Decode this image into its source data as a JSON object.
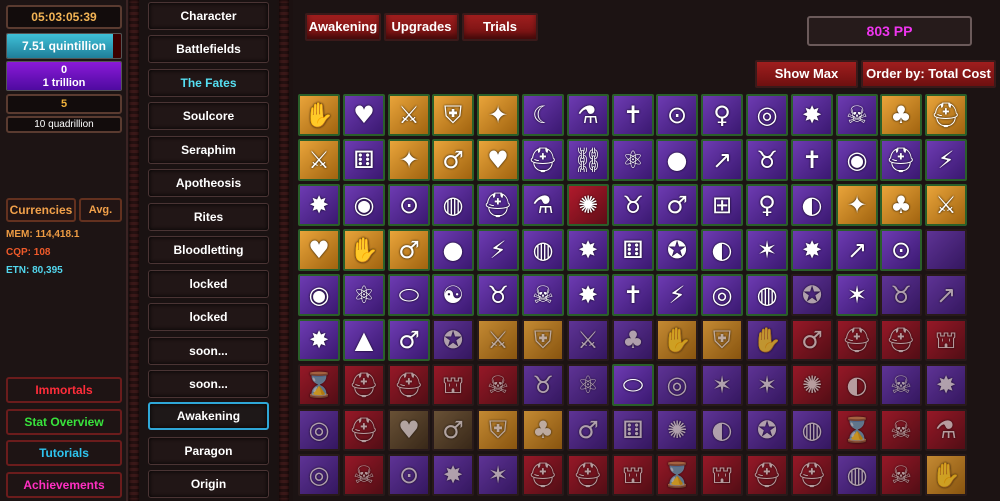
{
  "left": {
    "timer": "05:03:05:39",
    "bar1": {
      "label": "7.51 quintillion",
      "progress": 0.93
    },
    "bar2": {
      "line1": "0",
      "line2": "1 trillion",
      "progress": 1.0
    },
    "gold": "5",
    "quad": "10 quadrillion",
    "currencies": "Currencies",
    "avg": "Avg.",
    "mem": "MEM: 114,418.1",
    "cqp": "CQP: 108",
    "etn": "ETN: 80,395",
    "immortals": "Immortals",
    "stat_overview": "Stat Overview",
    "tutorials": "Tutorials",
    "achievements": "Achievements"
  },
  "nav": {
    "items": [
      {
        "label": "Character"
      },
      {
        "label": "Battlefields"
      },
      {
        "label": "The Fates"
      },
      {
        "label": "Soulcore"
      },
      {
        "label": "Seraphim"
      },
      {
        "label": "Apotheosis"
      },
      {
        "label": "Rites"
      },
      {
        "label": "Bloodletting"
      },
      {
        "label": "locked"
      },
      {
        "label": "locked"
      },
      {
        "label": "soon..."
      },
      {
        "label": "soon..."
      },
      {
        "label": "Awakening"
      },
      {
        "label": "Paragon"
      },
      {
        "label": "Origin"
      }
    ],
    "active": "Awakening"
  },
  "main": {
    "tabs": [
      {
        "label": "Awakening"
      },
      {
        "label": "Upgrades"
      },
      {
        "label": "Trials"
      }
    ],
    "pp": "803 PP",
    "show_max": "Show Max",
    "order_by": "Order by: Total Cost"
  },
  "grid": {
    "tiles": [
      {
        "c": "orange",
        "i": "claw-icon",
        "g": "✋",
        "l": false
      },
      {
        "c": "purple",
        "i": "heart-plus-icon",
        "g": "♥",
        "l": false
      },
      {
        "c": "orange",
        "i": "crossed-swords-icon",
        "g": "⚔",
        "l": false
      },
      {
        "c": "orange",
        "i": "shield-icon",
        "g": "⛨",
        "l": false
      },
      {
        "c": "orange",
        "i": "star-badge-icon",
        "g": "✦",
        "l": false
      },
      {
        "c": "purple",
        "i": "moon-face-icon",
        "g": "☾",
        "l": false
      },
      {
        "c": "purple",
        "i": "flask-icon",
        "g": "⚗",
        "l": false
      },
      {
        "c": "purple",
        "i": "angel-icon",
        "g": "✝",
        "l": false
      },
      {
        "c": "purple",
        "i": "keyhole-icon",
        "g": "⊙",
        "l": false
      },
      {
        "c": "purple",
        "i": "figure-icon",
        "g": "♀",
        "l": false
      },
      {
        "c": "purple",
        "i": "spiral-icon",
        "g": "◎",
        "l": false
      },
      {
        "c": "purple",
        "i": "explosion-icon",
        "g": "✸",
        "l": false
      },
      {
        "c": "purple",
        "i": "skull-icon",
        "g": "☠",
        "l": false
      },
      {
        "c": "orange",
        "i": "clover-icon",
        "g": "♣",
        "l": false
      },
      {
        "c": "orange",
        "i": "helmet-icon",
        "g": "⛑",
        "l": false
      },
      {
        "c": "orange",
        "i": "crossed-swords-icon",
        "g": "⚔",
        "l": false
      },
      {
        "c": "purple",
        "i": "dice-icon",
        "g": "⚅",
        "l": false
      },
      {
        "c": "orange",
        "i": "star-badge-icon",
        "g": "✦",
        "l": false
      },
      {
        "c": "orange",
        "i": "figure-icon",
        "g": "♂",
        "l": false
      },
      {
        "c": "orange",
        "i": "heart-plus-icon",
        "g": "♥",
        "l": false
      },
      {
        "c": "purple",
        "i": "helmet-icon",
        "g": "⛑",
        "l": false
      },
      {
        "c": "purple",
        "i": "chain-icon",
        "g": "⛓",
        "l": false
      },
      {
        "c": "purple",
        "i": "triskele-icon",
        "g": "⚛",
        "l": false
      },
      {
        "c": "purple",
        "i": "orb-icon",
        "g": "●",
        "l": false
      },
      {
        "c": "purple",
        "i": "growth-chart-icon",
        "g": "↗",
        "l": false
      },
      {
        "c": "purple",
        "i": "demon-icon",
        "g": "♉",
        "l": false
      },
      {
        "c": "purple",
        "i": "angel-icon",
        "g": "✝",
        "l": false
      },
      {
        "c": "purple",
        "i": "vortex-icon",
        "g": "◉",
        "l": false
      },
      {
        "c": "purple",
        "i": "helmet-icon",
        "g": "⛑",
        "l": false
      },
      {
        "c": "purple",
        "i": "lightning-icon",
        "g": "⚡",
        "l": false
      },
      {
        "c": "purple",
        "i": "explosion-icon",
        "g": "✸",
        "l": false
      },
      {
        "c": "purple",
        "i": "vortex-icon",
        "g": "◉",
        "l": false
      },
      {
        "c": "purple",
        "i": "keyhole-icon",
        "g": "⊙",
        "l": false
      },
      {
        "c": "purple",
        "i": "globe-icon",
        "g": "◍",
        "l": false
      },
      {
        "c": "purple",
        "i": "helmet-icon",
        "g": "⛑",
        "l": false
      },
      {
        "c": "purple",
        "i": "flask-icon",
        "g": "⚗",
        "l": false
      },
      {
        "c": "red",
        "i": "sunburst-icon",
        "g": "✺",
        "l": false
      },
      {
        "c": "purple",
        "i": "demon-face-icon",
        "g": "♉",
        "l": false
      },
      {
        "c": "purple",
        "i": "figure-icon",
        "g": "♂",
        "l": false
      },
      {
        "c": "purple",
        "i": "network-icon",
        "g": "⊞",
        "l": false
      },
      {
        "c": "purple",
        "i": "figure-icon",
        "g": "♀",
        "l": false
      },
      {
        "c": "purple",
        "i": "eye-icon",
        "g": "◐",
        "l": false
      },
      {
        "c": "orange",
        "i": "star-badge-icon",
        "g": "✦",
        "l": false
      },
      {
        "c": "orange",
        "i": "clover-icon",
        "g": "♣",
        "l": false
      },
      {
        "c": "orange",
        "i": "crossed-swords-icon",
        "g": "⚔",
        "l": false
      },
      {
        "c": "orange",
        "i": "heart-plus-icon",
        "g": "♥",
        "l": false
      },
      {
        "c": "orange",
        "i": "claw-icon",
        "g": "✋",
        "l": false
      },
      {
        "c": "orange",
        "i": "figure-icon",
        "g": "♂",
        "l": false
      },
      {
        "c": "purple",
        "i": "orb-icon",
        "g": "●",
        "l": false
      },
      {
        "c": "purple",
        "i": "lightning-icon",
        "g": "⚡",
        "l": false
      },
      {
        "c": "purple",
        "i": "globe-icon",
        "g": "◍",
        "l": false
      },
      {
        "c": "purple",
        "i": "explosion-icon",
        "g": "✸",
        "l": false
      },
      {
        "c": "purple",
        "i": "dice-icon",
        "g": "⚅",
        "l": false
      },
      {
        "c": "purple",
        "i": "thorn-ring-icon",
        "g": "✪",
        "l": false
      },
      {
        "c": "purple",
        "i": "eye-icon",
        "g": "◐",
        "l": false
      },
      {
        "c": "purple",
        "i": "heptagram-icon",
        "g": "✶",
        "l": false
      },
      {
        "c": "purple",
        "i": "explosion-icon",
        "g": "✸",
        "l": false
      },
      {
        "c": "purple",
        "i": "growth-chart-icon",
        "g": "↗",
        "l": false
      },
      {
        "c": "purple",
        "i": "keyhole-icon",
        "g": "⊙",
        "l": false
      },
      {
        "c": "purple",
        "i": "blank-icon",
        "g": "",
        "l": true
      },
      {
        "c": "purple",
        "i": "vortex-icon",
        "g": "◉",
        "l": false
      },
      {
        "c": "purple",
        "i": "triskele-icon",
        "g": "⚛",
        "l": false
      },
      {
        "c": "purple",
        "i": "egg-icon",
        "g": "⬭",
        "l": false
      },
      {
        "c": "purple",
        "i": "swirl-icon",
        "g": "☯",
        "l": false
      },
      {
        "c": "purple",
        "i": "demon-icon",
        "g": "♉",
        "l": false
      },
      {
        "c": "purple",
        "i": "skull-icon",
        "g": "☠",
        "l": false
      },
      {
        "c": "purple",
        "i": "explosion-icon",
        "g": "✸",
        "l": false
      },
      {
        "c": "purple",
        "i": "angel-icon",
        "g": "✝",
        "l": false
      },
      {
        "c": "purple",
        "i": "lightning-icon",
        "g": "⚡",
        "l": false
      },
      {
        "c": "purple",
        "i": "spiral-icon",
        "g": "◎",
        "l": false
      },
      {
        "c": "purple",
        "i": "globe-icon",
        "g": "◍",
        "l": false
      },
      {
        "c": "purple",
        "i": "thorn-ring-icon",
        "g": "✪",
        "l": true
      },
      {
        "c": "purple",
        "i": "heptagram-icon",
        "g": "✶",
        "l": false
      },
      {
        "c": "purple",
        "i": "demon-face-icon",
        "g": "♉",
        "l": true
      },
      {
        "c": "purple",
        "i": "growth-chart-icon",
        "g": "↗",
        "l": true
      },
      {
        "c": "purple",
        "i": "explosion-icon",
        "g": "✸",
        "l": false
      },
      {
        "c": "purple",
        "i": "pyramid-icon",
        "g": "▲",
        "l": false
      },
      {
        "c": "purple",
        "i": "figure-icon",
        "g": "♂",
        "l": false
      },
      {
        "c": "purple",
        "i": "thorn-ring-icon",
        "g": "✪",
        "l": true
      },
      {
        "c": "orange",
        "i": "crossed-swords-icon",
        "g": "⚔",
        "l": true
      },
      {
        "c": "orange",
        "i": "shield-icon",
        "g": "⛨",
        "l": true
      },
      {
        "c": "purple",
        "i": "crossed-swords-icon",
        "g": "⚔",
        "l": true
      },
      {
        "c": "purple",
        "i": "clover-icon",
        "g": "♣",
        "l": true
      },
      {
        "c": "orange",
        "i": "claw-icon",
        "g": "✋",
        "l": true
      },
      {
        "c": "orange",
        "i": "shield-icon",
        "g": "⛨",
        "l": true
      },
      {
        "c": "purple",
        "i": "claw-icon",
        "g": "✋",
        "l": true
      },
      {
        "c": "red",
        "i": "figure-icon",
        "g": "♂",
        "l": true
      },
      {
        "c": "red",
        "i": "helmet-icon",
        "g": "⛑",
        "l": true
      },
      {
        "c": "red",
        "i": "helmet-icon",
        "g": "⛑",
        "l": true
      },
      {
        "c": "red",
        "i": "hood-icon",
        "g": "⛫",
        "l": true
      },
      {
        "c": "red",
        "i": "hourglass-icon",
        "g": "⌛",
        "l": true
      },
      {
        "c": "red",
        "i": "helmet-icon",
        "g": "⛑",
        "l": true
      },
      {
        "c": "red",
        "i": "spartan-helmet-icon",
        "g": "⛑",
        "l": true
      },
      {
        "c": "red",
        "i": "hood-icon",
        "g": "⛫",
        "l": true
      },
      {
        "c": "red",
        "i": "slime-icon",
        "g": "☠",
        "l": true
      },
      {
        "c": "purple",
        "i": "demon-icon",
        "g": "♉",
        "l": true
      },
      {
        "c": "purple",
        "i": "triskele-icon",
        "g": "⚛",
        "l": true
      },
      {
        "c": "purple",
        "i": "egg-icon",
        "g": "⬭",
        "l": false
      },
      {
        "c": "purple",
        "i": "spiral-icon",
        "g": "◎",
        "l": true
      },
      {
        "c": "purple",
        "i": "heptagram-icon",
        "g": "✶",
        "l": true
      },
      {
        "c": "purple",
        "i": "heptagram-icon",
        "g": "✶",
        "l": true
      },
      {
        "c": "red",
        "i": "sunburst-icon",
        "g": "✺",
        "l": true
      },
      {
        "c": "red",
        "i": "eye-icon",
        "g": "◐",
        "l": true
      },
      {
        "c": "purple",
        "i": "skull-icon",
        "g": "☠",
        "l": true
      },
      {
        "c": "purple",
        "i": "explosion-icon",
        "g": "✸",
        "l": true
      },
      {
        "c": "purple",
        "i": "spiral-icon",
        "g": "◎",
        "l": true
      },
      {
        "c": "red",
        "i": "spartan-helmet-icon",
        "g": "⛑",
        "l": true
      },
      {
        "c": "brown",
        "i": "heart-plus-icon",
        "g": "♥",
        "l": true
      },
      {
        "c": "brown",
        "i": "figure-icon",
        "g": "♂",
        "l": true
      },
      {
        "c": "orange",
        "i": "shield-icon",
        "g": "⛨",
        "l": true
      },
      {
        "c": "orange",
        "i": "clover-icon",
        "g": "♣",
        "l": true
      },
      {
        "c": "purple",
        "i": "figure-icon",
        "g": "♂",
        "l": true
      },
      {
        "c": "purple",
        "i": "dice-icon",
        "g": "⚅",
        "l": true
      },
      {
        "c": "purple",
        "i": "sunburst-icon",
        "g": "✺",
        "l": true
      },
      {
        "c": "purple",
        "i": "eye-icon",
        "g": "◐",
        "l": true
      },
      {
        "c": "purple",
        "i": "thorn-ring-icon",
        "g": "✪",
        "l": true
      },
      {
        "c": "purple",
        "i": "globe-icon",
        "g": "◍",
        "l": true
      },
      {
        "c": "red",
        "i": "hourglass-icon",
        "g": "⌛",
        "l": true
      },
      {
        "c": "red",
        "i": "skull-icon",
        "g": "☠",
        "l": true
      },
      {
        "c": "red",
        "i": "potion-icon",
        "g": "⚗",
        "l": true
      },
      {
        "c": "purple",
        "i": "spiral-icon",
        "g": "◎",
        "l": true
      },
      {
        "c": "red",
        "i": "slime-icon",
        "g": "☠",
        "l": true
      },
      {
        "c": "purple",
        "i": "keyhole-icon",
        "g": "⊙",
        "l": true
      },
      {
        "c": "purple",
        "i": "explosion-icon",
        "g": "✸",
        "l": true
      },
      {
        "c": "purple",
        "i": "heptagram-icon",
        "g": "✶",
        "l": true
      },
      {
        "c": "red",
        "i": "helmet-icon",
        "g": "⛑",
        "l": true
      },
      {
        "c": "red",
        "i": "spartan-helmet-icon",
        "g": "⛑",
        "l": true
      },
      {
        "c": "red",
        "i": "hood-icon",
        "g": "⛫",
        "l": true
      },
      {
        "c": "red",
        "i": "hourglass-icon",
        "g": "⌛",
        "l": true
      },
      {
        "c": "red",
        "i": "hood-icon",
        "g": "⛫",
        "l": true
      },
      {
        "c": "red",
        "i": "helmet-icon",
        "g": "⛑",
        "l": true
      },
      {
        "c": "red",
        "i": "helmet-icon",
        "g": "⛑",
        "l": true
      },
      {
        "c": "purple",
        "i": "globe-icon",
        "g": "◍",
        "l": true
      },
      {
        "c": "red",
        "i": "slime-icon",
        "g": "☠",
        "l": true
      },
      {
        "c": "orange",
        "i": "claw-icon",
        "g": "✋",
        "l": true
      }
    ]
  }
}
